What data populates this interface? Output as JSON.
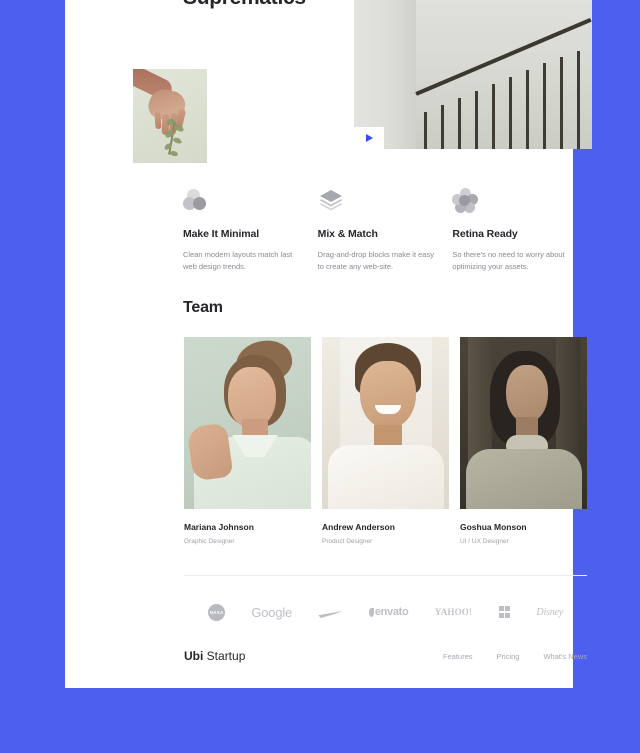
{
  "theme": {
    "background_blue": "#4d5fef",
    "sheet_white": "#ffffff",
    "heading_color": "#26262b",
    "muted_text": "#8a8a92",
    "accent_play": "#3a4bec"
  },
  "hero": {
    "title": "Suprematics",
    "video": {
      "play_icon": "play-triangle-icon",
      "photo_alt": "staircase-railing-photo"
    },
    "side_photo_alt": "hand-holding-herbs-photo"
  },
  "features": [
    {
      "icon": "circles-icon",
      "title": "Make It Minimal",
      "description": "Clean modern layouts match last web design trends."
    },
    {
      "icon": "layers-icon",
      "title": "Mix & Match",
      "description": "Drag-and-drop blocks make it easy to create any web-site."
    },
    {
      "icon": "flower-icon",
      "title": "Retina Ready",
      "description": "So there's no need to worry about optimizing your assets."
    }
  ],
  "team": {
    "heading": "Team",
    "members": [
      {
        "name": "Mariana Johnson",
        "role": "Graphic Designer",
        "photo_alt": "portrait-mariana"
      },
      {
        "name": "Andrew Anderson",
        "role": "Product Designer",
        "photo_alt": "portrait-andrew"
      },
      {
        "name": "Goshua Monson",
        "role": "UI / UX Designer",
        "photo_alt": "portrait-goshua"
      }
    ]
  },
  "logos": [
    {
      "name": "nasa",
      "label": "NASA"
    },
    {
      "name": "google",
      "label": "Google"
    },
    {
      "name": "nike",
      "label": "Nike"
    },
    {
      "name": "envato",
      "label": "envato"
    },
    {
      "name": "yahoo",
      "label": "YAHOO!"
    },
    {
      "name": "microsoft",
      "label": "Microsoft"
    },
    {
      "name": "disney",
      "label": "Disney"
    }
  ],
  "footer": {
    "brand_bold": "Ubi",
    "brand_light": " Startup",
    "links": [
      {
        "label": "Features"
      },
      {
        "label": "Pricing"
      },
      {
        "label": "What's News"
      }
    ]
  }
}
